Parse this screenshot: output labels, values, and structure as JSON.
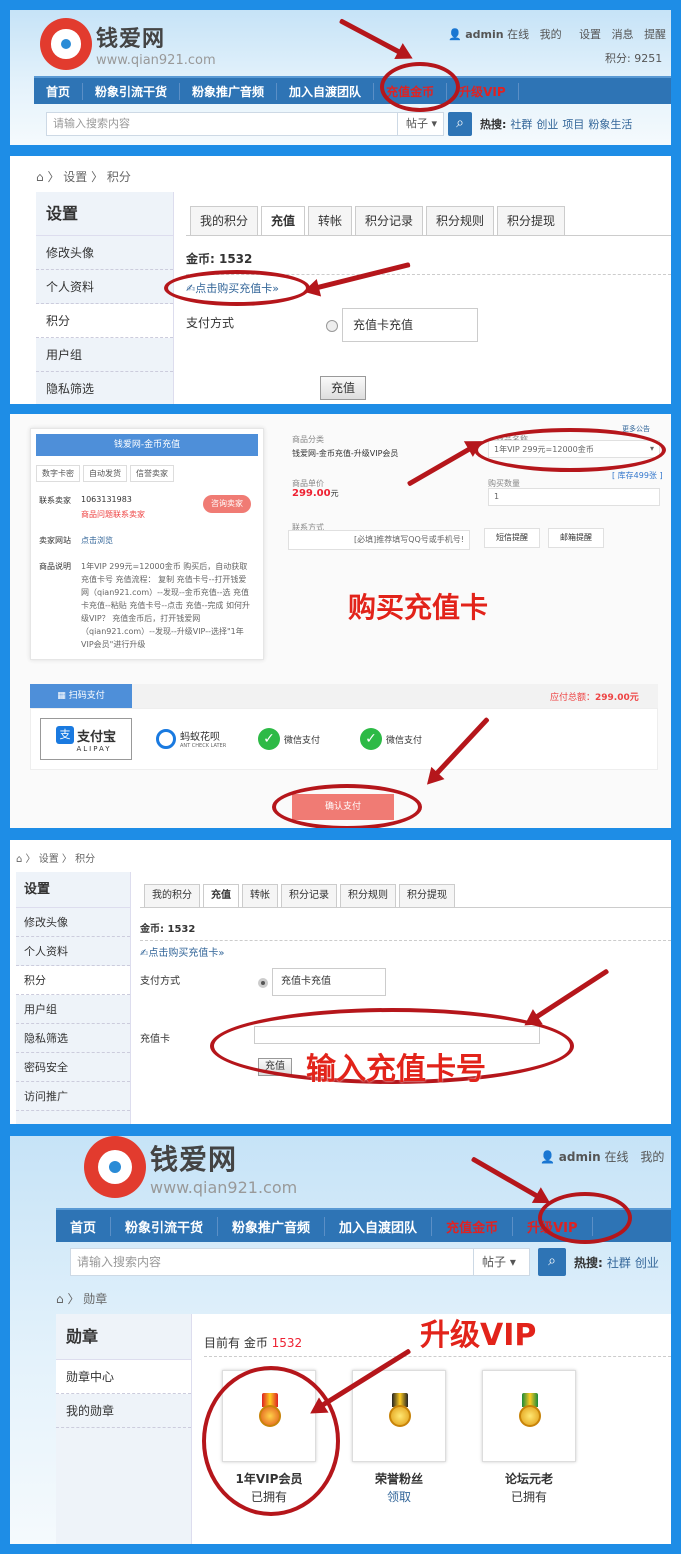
{
  "site": {
    "logo_name": "钱爱网",
    "logo_url": "www.qian921.com"
  },
  "header": {
    "user": "admin",
    "online": "在线",
    "mine": "我的",
    "settings": "设置",
    "messages": "消息",
    "remind": "提醒",
    "points": "积分: 9251"
  },
  "nav": [
    "首页",
    "粉象引流干货",
    "粉象推广音频",
    "加入自渡团队",
    "充值金币",
    "升级VIP"
  ],
  "search": {
    "placeholder": "请输入搜索内容",
    "type": "帖子",
    "hot_label": "热搜:",
    "hot": [
      "社群",
      "创业",
      "项目",
      "粉象生活"
    ]
  },
  "settings": {
    "crumb_settings": "设置",
    "crumb_points": "积分",
    "side_title": "设置",
    "side_items": [
      "修改头像",
      "个人资料",
      "积分",
      "用户组",
      "隐私筛选",
      "密码安全",
      "访问推广"
    ],
    "tabs": [
      "我的积分",
      "充值",
      "转帐",
      "积分记录",
      "积分规则",
      "积分提现"
    ],
    "gold": "金币: 1532",
    "buy_link": "✍点击购买充值卡»",
    "pay_method": "支付方式",
    "card_option": "充值卡充值",
    "card_label": "充值卡",
    "submit": "充值"
  },
  "shop": {
    "title": "钱爱网-金币充值",
    "tags": [
      "数字卡密",
      "自动发货",
      "信誉卖家"
    ],
    "seller_label": "联系卖家",
    "seller_qq": "1063131983",
    "seller_note": "商品问题联系卖家",
    "consult_btn": "咨询卖家",
    "site_label": "卖家网站",
    "site_link": "点击浏览",
    "desc_label": "商品说明",
    "desc": "1年VIP 299元=12000金币 购买后，自动获取 充值卡号 充值流程： 复制 充值卡号--打开钱爱网（qian921.com）--发现--金币充值--选 充值卡充值--粘贴 充值卡号--点击 充值--完成 如何升级VIP？ 充值金币后，打开钱爱网（qian921.com）--发现--升级VIP--选择\"1年VIP会员\"进行升级",
    "cat_label": "商品分类",
    "cat_value": "钱爱网-金币充值-升级VIP会员",
    "name_label": "商品名称",
    "select_value": "1年VIP 299元=12000金币",
    "more": "更多公告",
    "stock": "[ 库存499张 ]",
    "price_label": "商品单价",
    "price": "299.00",
    "unit": "元",
    "qty_label": "购买数量",
    "qty": "1",
    "contact_label": "联系方式",
    "contact_ph": "[必填]推荐填写QQ号或手机号!",
    "sms_btn": "短信提醒",
    "mail_btn": "邮箱提醒",
    "scan_pay": "扫码支付",
    "total_label": "应付总额：",
    "total_value": "299.00元",
    "pay_methods": [
      "支付宝",
      "蚂蚁花呗",
      "微信支付",
      "微信支付"
    ],
    "alipay_en": "ALIPAY",
    "huabei_en": "ANT CHECK LATER",
    "confirm": "确认支付"
  },
  "medals": {
    "crumb": "勋章",
    "side_title": "勋章",
    "side_items": [
      "勋章中心",
      "我的勋章"
    ],
    "gold_prefix": "目前有 金币",
    "gold_value": "1532",
    "items": [
      {
        "name": "1年VIP会员",
        "status": "已拥有"
      },
      {
        "name": "荣誉粉丝",
        "status": "领取"
      },
      {
        "name": "论坛元老",
        "status": "已拥有"
      }
    ]
  },
  "annotations": {
    "buy_card": "购买充值卡",
    "enter_card": "输入充值卡号",
    "upgrade": "升级VIP"
  },
  "colors": {
    "nav": "#2e74b5",
    "annotation": "#b5161b",
    "frame": "#1e8de6"
  }
}
